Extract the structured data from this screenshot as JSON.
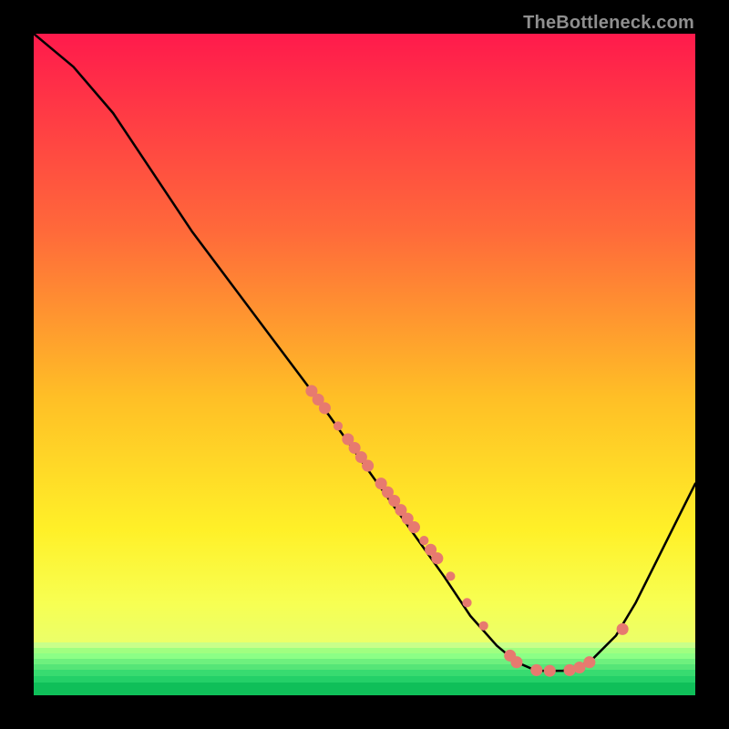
{
  "watermark": "TheBottleneck.com",
  "colors": {
    "marker": "#e77a6f",
    "curve": "#000000"
  },
  "chart_data": {
    "type": "line",
    "title": "",
    "xlabel": "",
    "ylabel": "",
    "xlim": [
      0,
      100
    ],
    "ylim": [
      0,
      100
    ],
    "note": "y is rendered with 0 at top, 100 at bottom (inverted image coords)",
    "curve": [
      {
        "x": 0,
        "y": 0
      },
      {
        "x": 6,
        "y": 5
      },
      {
        "x": 12,
        "y": 12
      },
      {
        "x": 18,
        "y": 21
      },
      {
        "x": 24,
        "y": 30
      },
      {
        "x": 30,
        "y": 38
      },
      {
        "x": 36,
        "y": 46
      },
      {
        "x": 42,
        "y": 54
      },
      {
        "x": 47,
        "y": 61
      },
      {
        "x": 52,
        "y": 68
      },
      {
        "x": 57,
        "y": 75
      },
      {
        "x": 62,
        "y": 82
      },
      {
        "x": 66,
        "y": 88
      },
      {
        "x": 70,
        "y": 92.5
      },
      {
        "x": 73,
        "y": 95
      },
      {
        "x": 76,
        "y": 96.3
      },
      {
        "x": 80,
        "y": 96.3
      },
      {
        "x": 84,
        "y": 95
      },
      {
        "x": 88,
        "y": 91
      },
      {
        "x": 91,
        "y": 86
      },
      {
        "x": 94,
        "y": 80
      },
      {
        "x": 97,
        "y": 74
      },
      {
        "x": 100,
        "y": 68
      }
    ],
    "markers": [
      {
        "x": 42.0,
        "y": 54.0,
        "r": 0.9
      },
      {
        "x": 43.0,
        "y": 55.3,
        "r": 0.9
      },
      {
        "x": 44.0,
        "y": 56.6,
        "r": 0.9
      },
      {
        "x": 46.0,
        "y": 59.3,
        "r": 0.7
      },
      {
        "x": 47.5,
        "y": 61.3,
        "r": 0.9
      },
      {
        "x": 48.5,
        "y": 62.6,
        "r": 0.9
      },
      {
        "x": 49.5,
        "y": 64.0,
        "r": 0.9
      },
      {
        "x": 50.5,
        "y": 65.3,
        "r": 0.9
      },
      {
        "x": 52.5,
        "y": 68.0,
        "r": 0.9
      },
      {
        "x": 53.5,
        "y": 69.3,
        "r": 0.9
      },
      {
        "x": 54.5,
        "y": 70.6,
        "r": 0.9
      },
      {
        "x": 55.5,
        "y": 72.0,
        "r": 0.9
      },
      {
        "x": 56.5,
        "y": 73.3,
        "r": 0.9
      },
      {
        "x": 57.5,
        "y": 74.6,
        "r": 0.9
      },
      {
        "x": 59.0,
        "y": 76.6,
        "r": 0.7
      },
      {
        "x": 60.0,
        "y": 78.0,
        "r": 0.9
      },
      {
        "x": 61.0,
        "y": 79.3,
        "r": 0.9
      },
      {
        "x": 63.0,
        "y": 82.0,
        "r": 0.7
      },
      {
        "x": 65.5,
        "y": 86.0,
        "r": 0.7
      },
      {
        "x": 68.0,
        "y": 89.5,
        "r": 0.7
      },
      {
        "x": 72.0,
        "y": 94.0,
        "r": 0.9
      },
      {
        "x": 73.0,
        "y": 95.0,
        "r": 0.9
      },
      {
        "x": 76.0,
        "y": 96.2,
        "r": 0.9
      },
      {
        "x": 78.0,
        "y": 96.3,
        "r": 0.9
      },
      {
        "x": 81.0,
        "y": 96.2,
        "r": 0.9
      },
      {
        "x": 82.5,
        "y": 95.8,
        "r": 0.9
      },
      {
        "x": 84.0,
        "y": 95.0,
        "r": 0.9
      },
      {
        "x": 89.0,
        "y": 90.0,
        "r": 0.9
      }
    ]
  }
}
